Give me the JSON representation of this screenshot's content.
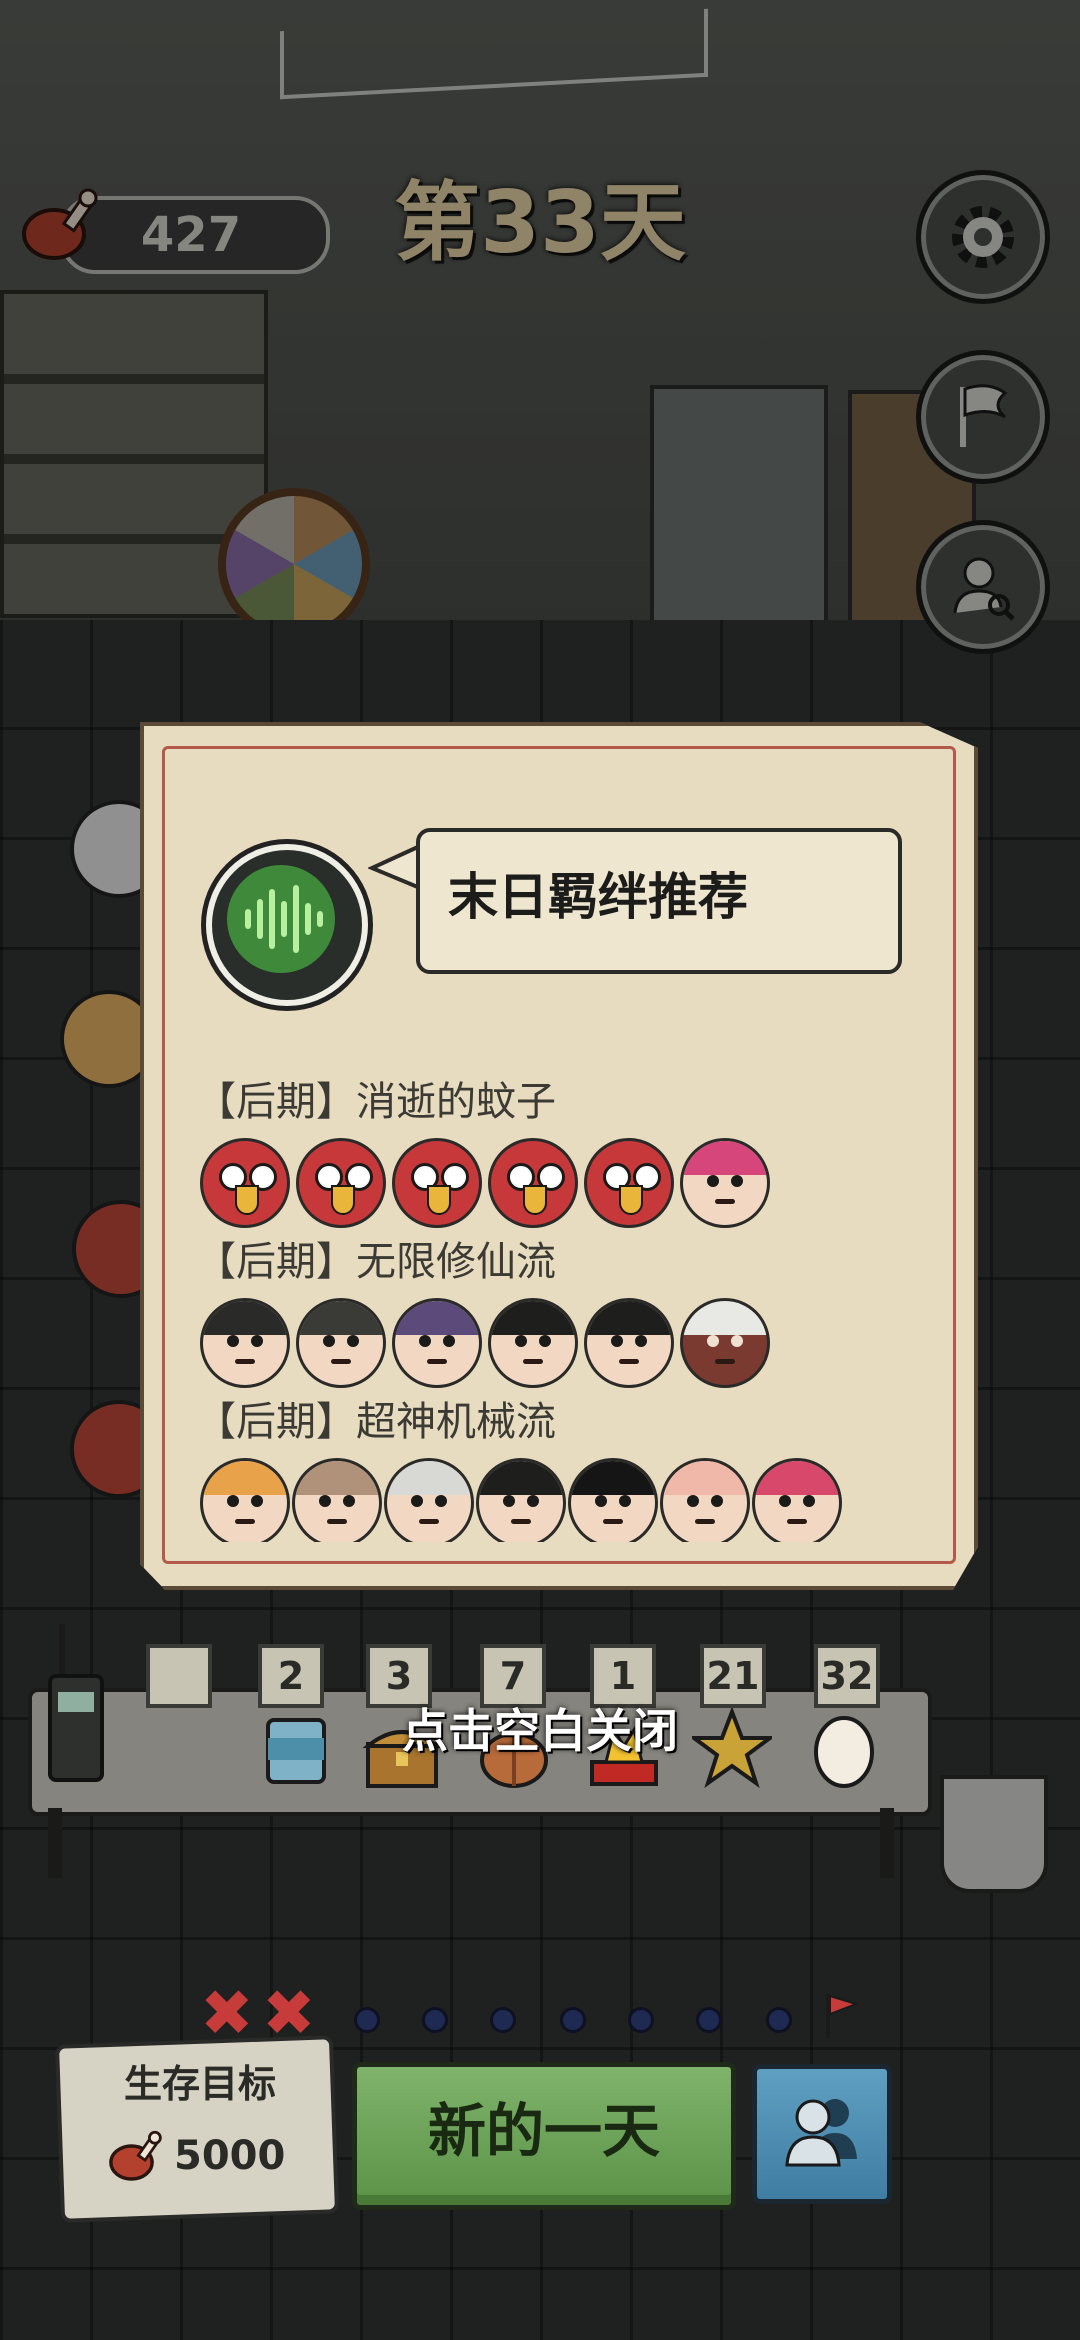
{
  "hud": {
    "food_count": "427",
    "day_title": "第33天",
    "buttons": {
      "settings_icon": "gear-icon",
      "flag_icon": "flag-icon",
      "search_user_icon": "user-search-icon"
    }
  },
  "modal": {
    "voice_icon": "voice-wave-icon",
    "title": "末日羁绊推荐",
    "groups": [
      {
        "label": "【后期】消逝的蚊子",
        "portraits": 6
      },
      {
        "label": "【后期】无限修仙流",
        "portraits": 6
      },
      {
        "label": "【后期】超神机械流",
        "portraits": 7
      }
    ]
  },
  "close_hint": "点击空白关闭",
  "inventory": {
    "counters": [
      "2",
      "3",
      "7",
      "1",
      "21",
      "32"
    ],
    "items": [
      "walkie-talkie-icon",
      "can-icon",
      "treasure-chest-icon",
      "basket-icon",
      "burger-icon",
      "star-icon",
      "egg-icon"
    ]
  },
  "progress": {
    "failed_marks": 2,
    "remaining_dots": 7,
    "end_flag_icon": "flag-icon"
  },
  "goal": {
    "title": "生存目标",
    "value": "5000"
  },
  "actions": {
    "new_day": "新的一天",
    "team_icon": "team-icon"
  },
  "colors": {
    "modal_bg": "#e8dcc0",
    "newday_green": "#6ea55a",
    "team_blue": "#4f8fb3",
    "title_gold": "#e7d3a8"
  }
}
